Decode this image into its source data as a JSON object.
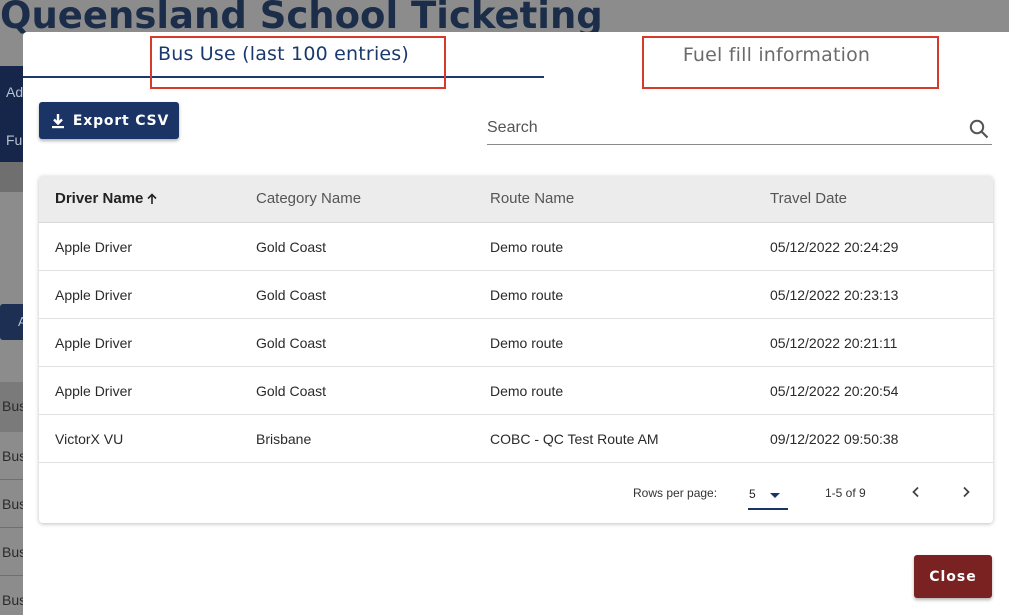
{
  "background": {
    "app_title": "Queensland School Ticketing",
    "nav_items": [
      "Ad",
      "Fu"
    ],
    "button_fragment": "A",
    "header_fragment": "Bus",
    "row_fragments": [
      "Bus",
      "Bus",
      "Bus",
      "Bus"
    ]
  },
  "modal": {
    "tabs": [
      {
        "label": "Bus Use (last 100 entries)",
        "active": true
      },
      {
        "label": "Fuel fill information",
        "active": false
      }
    ],
    "highlight_color": "#d63a2a",
    "export_label": "Export CSV",
    "search": {
      "placeholder": "Search",
      "value": ""
    },
    "table": {
      "columns": [
        "Driver Name",
        "Category Name",
        "Route Name",
        "Travel Date"
      ],
      "sorted_column": "Driver Name",
      "sort_direction": "ascending",
      "rows": [
        [
          "Apple Driver",
          "Gold Coast",
          "Demo route",
          "05/12/2022 20:24:29"
        ],
        [
          "Apple Driver",
          "Gold Coast",
          "Demo route",
          "05/12/2022 20:23:13"
        ],
        [
          "Apple Driver",
          "Gold Coast",
          "Demo route",
          "05/12/2022 20:21:11"
        ],
        [
          "Apple Driver",
          "Gold Coast",
          "Demo route",
          "05/12/2022 20:20:54"
        ],
        [
          "VictorX VU",
          "Brisbane",
          "COBC - QC Test Route AM",
          "09/12/2022 09:50:38"
        ]
      ]
    },
    "pagination": {
      "rows_per_page_label": "Rows per page:",
      "rows_per_page": "5",
      "range": "1-5 of 9"
    },
    "close_label": "Close",
    "colors": {
      "primary": "#1a3466",
      "close": "#7a2222"
    }
  }
}
